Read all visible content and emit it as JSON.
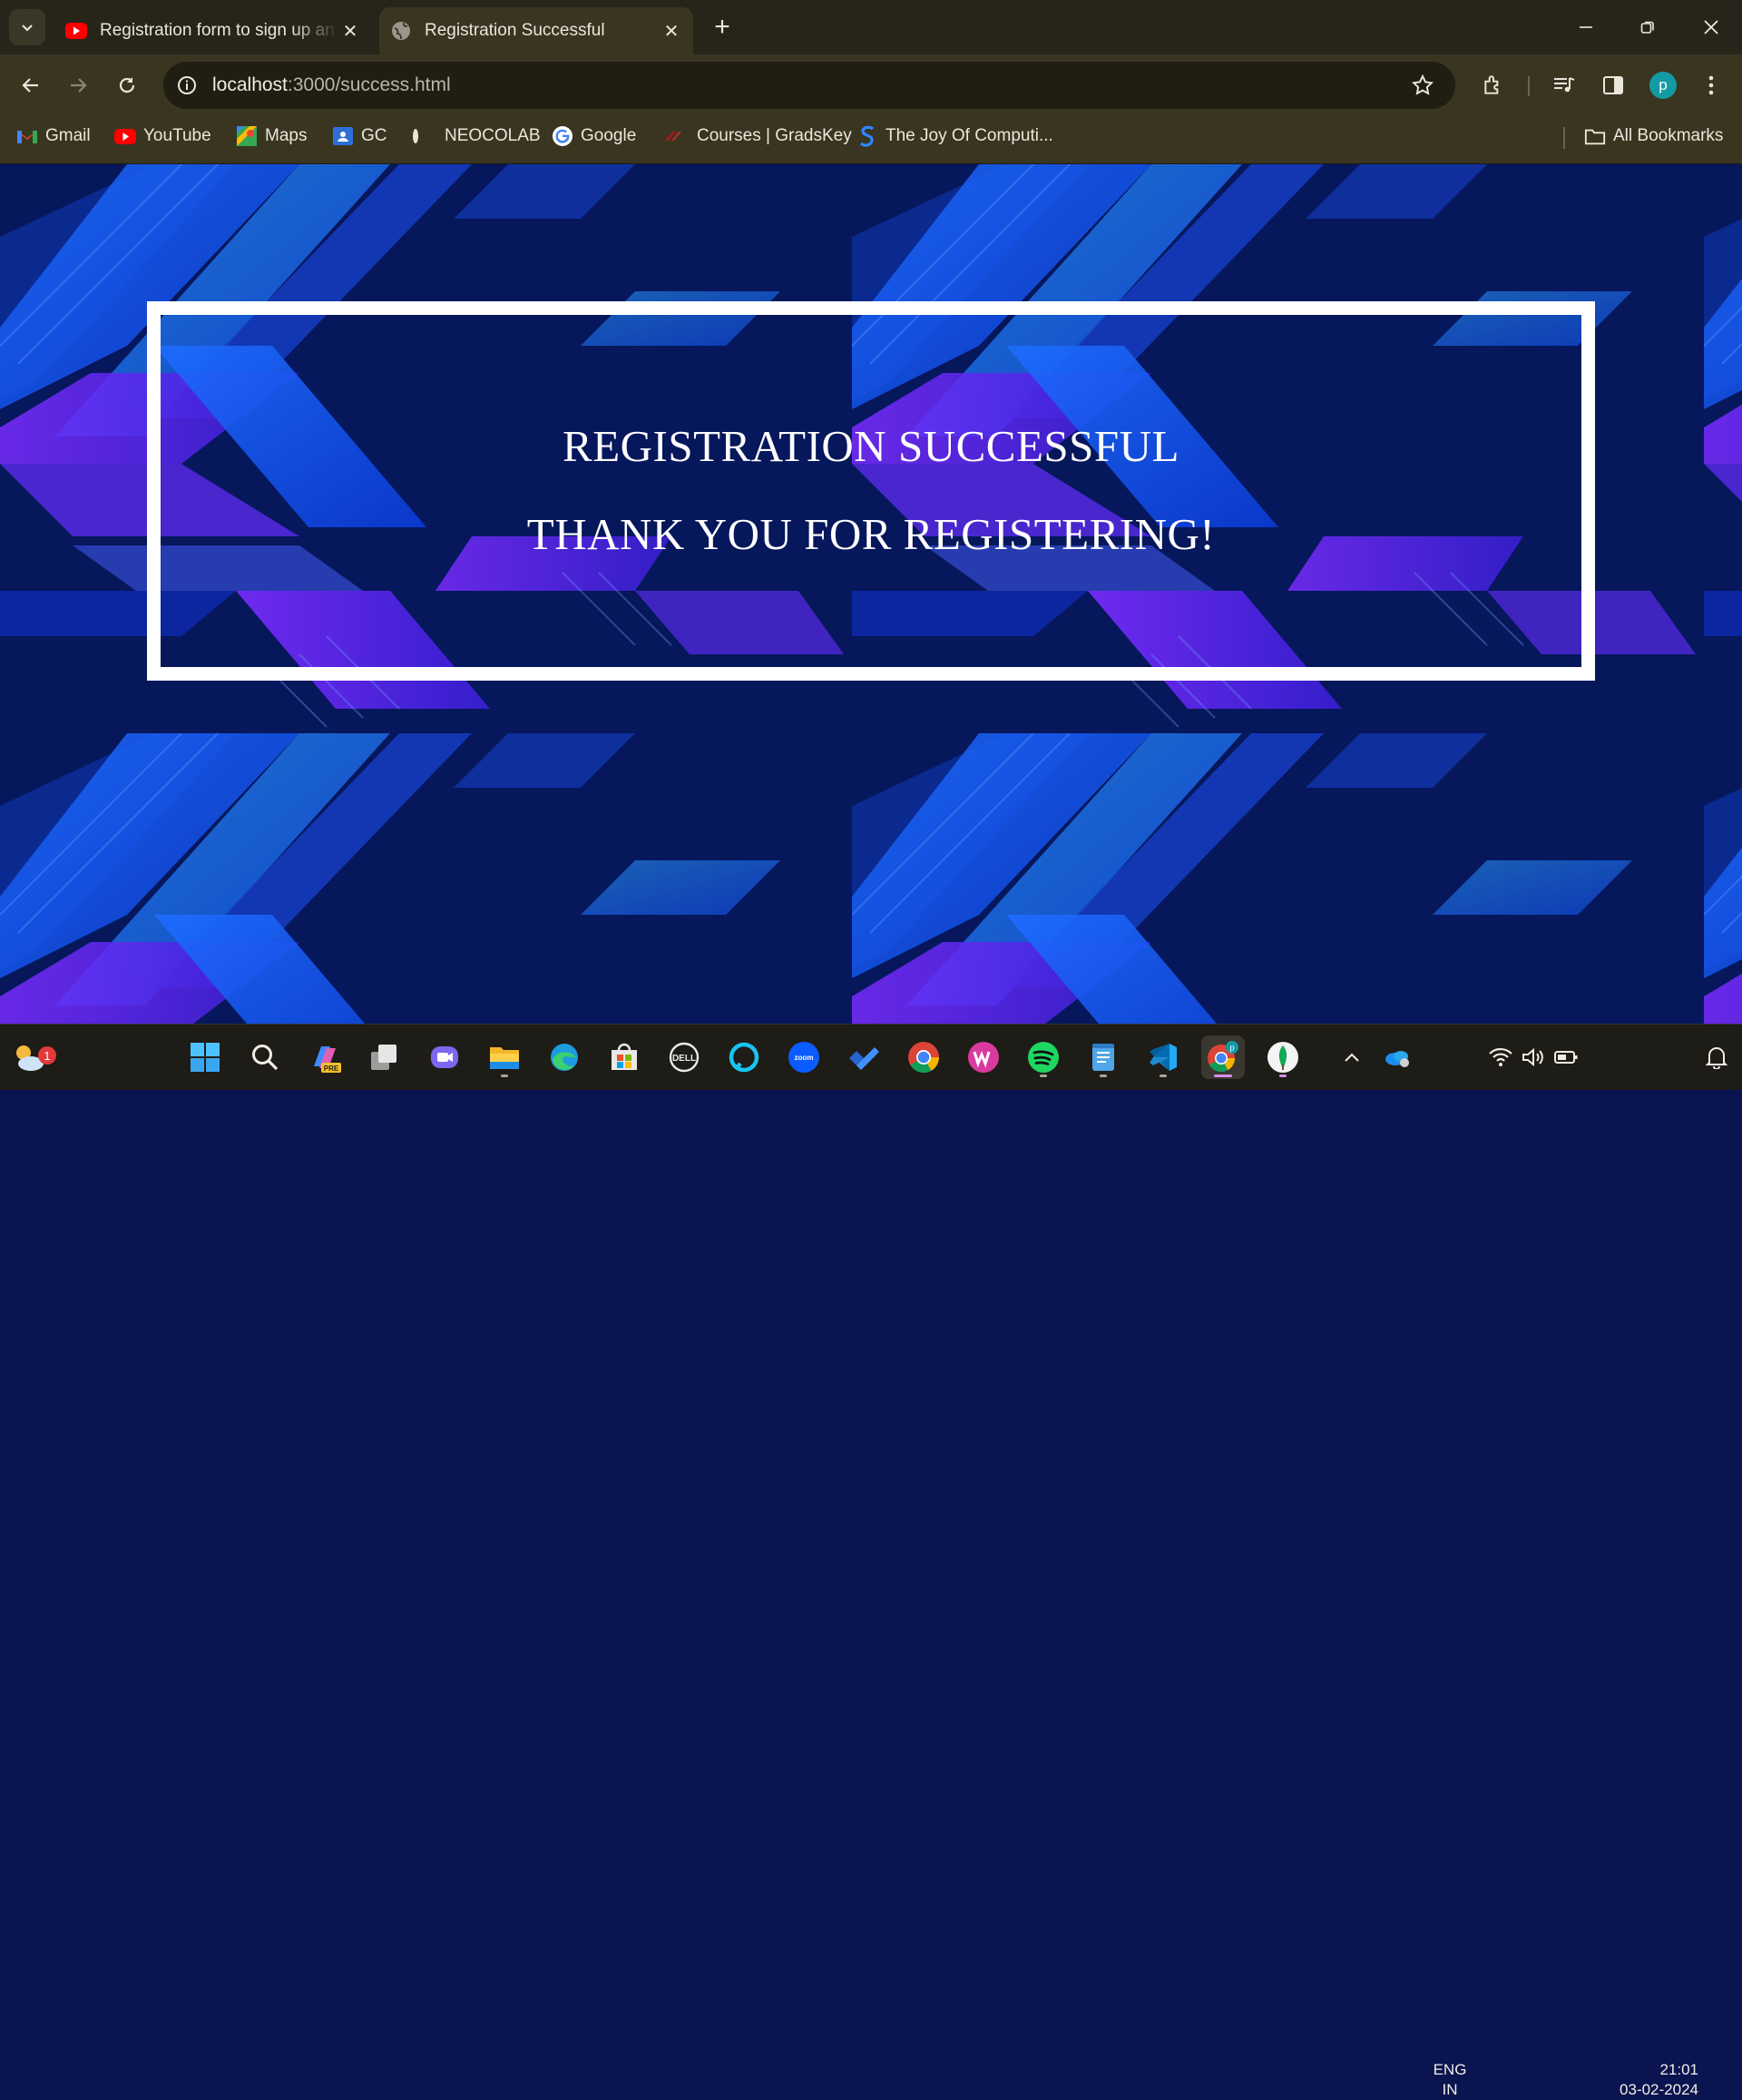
{
  "browser": {
    "tabs": [
      {
        "title": "Registration form to sign up an",
        "active": false,
        "favicon": "youtube-icon"
      },
      {
        "title": "Registration Successful",
        "active": true,
        "favicon": "globe-icon"
      }
    ],
    "url_host": "localhost",
    "url_path": ":3000/success.html",
    "profile_letter": "p",
    "bookmarks": [
      {
        "label": "Gmail",
        "icon": "gmail-icon"
      },
      {
        "label": "YouTube",
        "icon": "youtube-icon"
      },
      {
        "label": "Maps",
        "icon": "maps-icon"
      },
      {
        "label": "GC",
        "icon": "classroom-icon"
      },
      {
        "label": "NEOCOLAB",
        "icon": "neocolab-icon"
      },
      {
        "label": "Google",
        "icon": "google-icon"
      },
      {
        "label": "Courses | GradsKey",
        "icon": "gradskey-icon"
      },
      {
        "label": "The Joy Of Computi...",
        "icon": "swayam-icon"
      }
    ],
    "all_bookmarks": "All Bookmarks"
  },
  "page": {
    "heading": "REGISTRATION SUCCESSFUL",
    "message": "THANK YOU FOR REGISTERING!",
    "colors": {
      "background": "#06175c",
      "border": "#ffffff",
      "text": "#ffffff"
    }
  },
  "taskbar": {
    "weather_badge": "1",
    "apps": [
      "start-icon",
      "search-icon",
      "copilot-icon",
      "task-view-icon",
      "teams-icon",
      "file-explorer-icon",
      "edge-icon",
      "store-icon",
      "dell-icon",
      "alexa-icon",
      "zoom-icon",
      "todo-icon",
      "chrome-icon",
      "wps-icon",
      "spotify-icon",
      "notepad-icon",
      "vscode-icon",
      "chrome-profile-icon",
      "mongodb-compass-icon"
    ],
    "language_top": "ENG",
    "language_bottom": "IN",
    "time": "21:01",
    "date": "03-02-2024"
  }
}
